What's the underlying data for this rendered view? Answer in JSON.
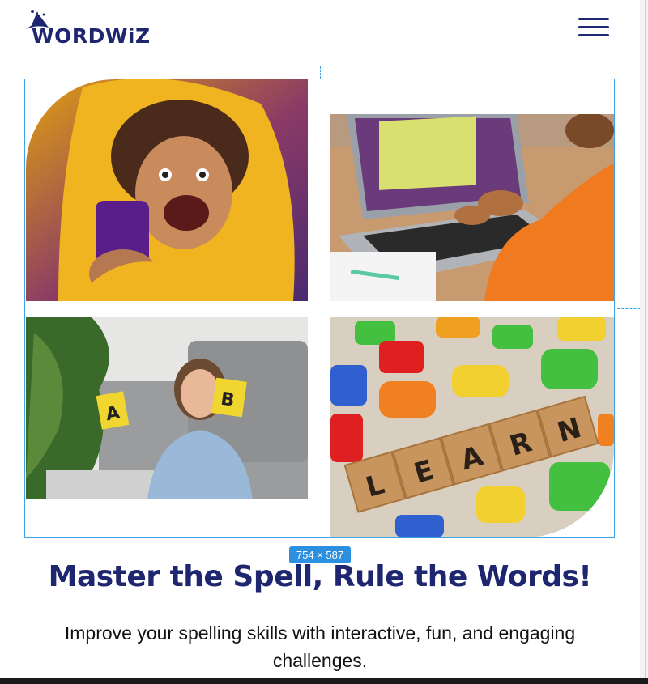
{
  "header": {
    "logo_text": "WORDWiZ",
    "menu_icon": "hamburger-menu-icon"
  },
  "gallery": {
    "images": [
      {
        "name": "child-with-phone-image"
      },
      {
        "name": "child-laptop-math-image"
      },
      {
        "name": "girl-letter-cards-image"
      },
      {
        "name": "learn-blocks-image"
      }
    ]
  },
  "editor_overlay": {
    "size_label": "754 × 587"
  },
  "hero": {
    "title": "Master the Spell, Rule the Words!",
    "subtitle": "Improve your spelling skills with interactive, fun, and engaging challenges."
  },
  "colors": {
    "brand": "#1f2670",
    "selection": "#3fa4e6",
    "badge": "#2d8fe0"
  }
}
